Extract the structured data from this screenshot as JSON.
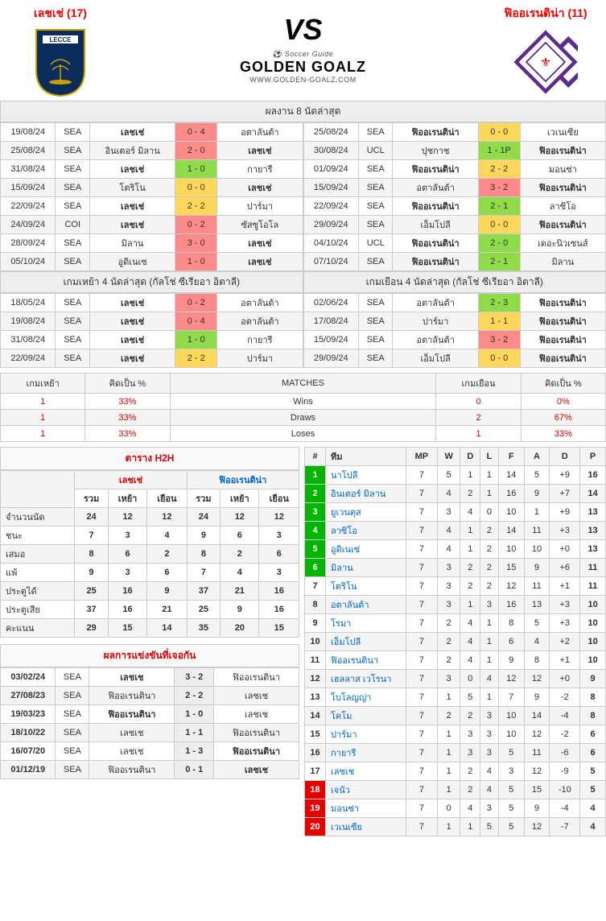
{
  "header": {
    "home_name": "เลชเช่ (17)",
    "away_name": "ฟิออเรนติน่า (11)",
    "vs": "VS",
    "brand_main": "GOLDEN GOALZ",
    "brand_sub_top": "Soccer Guide",
    "brand_sub_bot": "WWW.GOLDEN-GOALZ.COM"
  },
  "sections": {
    "last8": "ผลงาน 8 นัดล่าสุด",
    "home4": "เกมเหย้า 4 นัดล่าสุด (กัลโช่ ซีเรียอา อิตาลี)",
    "away4": "เกมเยือน 4 นัดล่าสุด (กัลโช่ ซีเรียอา อิตาลี)",
    "h2h_table": "ตาราง H2H",
    "h2h_meet": "ผลการแข่งขันที่เจอกัน",
    "wins": "Wins",
    "draws": "Draws",
    "loses": "Loses",
    "matches": "MATCHES",
    "home_g": "เกมเหย้า",
    "away_g": "เกมเยือน",
    "pct": "คิดเป็น %"
  },
  "last8_home": [
    {
      "d": "19/08/24",
      "c": "SEA",
      "h": "เลชเช่",
      "s": "0 - 4",
      "a": "อตาลันต้า",
      "hb": true,
      "cls": "red-box"
    },
    {
      "d": "25/08/24",
      "c": "SEA",
      "h": "อินเตอร์ มิลาน",
      "s": "2 - 0",
      "a": "เลชเช่",
      "ab": true,
      "cls": "red-box"
    },
    {
      "d": "31/08/24",
      "c": "SEA",
      "h": "เลชเช่",
      "s": "1 - 0",
      "a": "กายารี",
      "hb": true,
      "cls": "green-box"
    },
    {
      "d": "15/09/24",
      "c": "SEA",
      "h": "โตริโน",
      "s": "0 - 0",
      "a": "เลชเช่",
      "ab": true,
      "cls": "yellow-box"
    },
    {
      "d": "22/09/24",
      "c": "SEA",
      "h": "เลชเช่",
      "s": "2 - 2",
      "a": "ปาร์มา",
      "hb": true,
      "cls": "yellow-box"
    },
    {
      "d": "24/09/24",
      "c": "COI",
      "h": "เลชเช่",
      "s": "0 - 2",
      "a": "ซัสซูโอโล",
      "hb": true,
      "cls": "red-box"
    },
    {
      "d": "28/09/24",
      "c": "SEA",
      "h": "มิลาน",
      "s": "3 - 0",
      "a": "เลชเช่",
      "ab": true,
      "cls": "red-box"
    },
    {
      "d": "05/10/24",
      "c": "SEA",
      "h": "อูดิเนเซ",
      "s": "1 - 0",
      "a": "เลชเช่",
      "ab": true,
      "cls": "red-box"
    }
  ],
  "last8_away": [
    {
      "d": "25/08/24",
      "c": "SEA",
      "h": "ฟิออเรนติน่า",
      "s": "0 - 0",
      "a": "เวเนเซีย",
      "hb": true,
      "cls": "yellow-box"
    },
    {
      "d": "30/08/24",
      "c": "UCL",
      "h": "ปุชกาช",
      "s": "1 - 1P",
      "a": "ฟิออเรนติน่า",
      "ab": true,
      "cls": "green-box"
    },
    {
      "d": "01/09/24",
      "c": "SEA",
      "h": "ฟิออเรนติน่า",
      "s": "2 - 2",
      "a": "มอนซ่า",
      "hb": true,
      "cls": "yellow-box"
    },
    {
      "d": "15/09/24",
      "c": "SEA",
      "h": "อตาลันต้า",
      "s": "3 - 2",
      "a": "ฟิออเรนติน่า",
      "ab": true,
      "cls": "red-box"
    },
    {
      "d": "22/09/24",
      "c": "SEA",
      "h": "ฟิออเรนติน่า",
      "s": "2 - 1",
      "a": "ลาซิโอ",
      "hb": true,
      "cls": "green-box"
    },
    {
      "d": "29/09/24",
      "c": "SEA",
      "h": "เอ็มโปลี",
      "s": "0 - 0",
      "a": "ฟิออเรนติน่า",
      "ab": true,
      "cls": "yellow-box"
    },
    {
      "d": "04/10/24",
      "c": "UCL",
      "h": "ฟิออเรนติน่า",
      "s": "2 - 0",
      "a": "เดอะนิวเซนส์",
      "hb": true,
      "cls": "green-box"
    },
    {
      "d": "07/10/24",
      "c": "SEA",
      "h": "ฟิออเรนติน่า",
      "s": "2 - 1",
      "a": "มิลาน",
      "hb": true,
      "cls": "green-box"
    }
  ],
  "home4": [
    {
      "d": "18/05/24",
      "c": "SEA",
      "h": "เลชเช่",
      "s": "0 - 2",
      "a": "อตาลันต้า",
      "hb": true,
      "cls": "red-box"
    },
    {
      "d": "19/08/24",
      "c": "SEA",
      "h": "เลชเช่",
      "s": "0 - 4",
      "a": "อตาลันต้า",
      "hb": true,
      "cls": "red-box"
    },
    {
      "d": "31/08/24",
      "c": "SEA",
      "h": "เลชเช่",
      "s": "1 - 0",
      "a": "กายารี",
      "hb": true,
      "cls": "green-box"
    },
    {
      "d": "22/09/24",
      "c": "SEA",
      "h": "เลชเช่",
      "s": "2 - 2",
      "a": "ปาร์มา",
      "hb": true,
      "cls": "yellow-box"
    }
  ],
  "away4": [
    {
      "d": "02/06/24",
      "c": "SEA",
      "h": "อตาลันต้า",
      "s": "2 - 3",
      "a": "ฟิออเรนติน่า",
      "ab": true,
      "cls": "green-box"
    },
    {
      "d": "17/08/24",
      "c": "SEA",
      "h": "ปาร์มา",
      "s": "1 - 1",
      "a": "ฟิออเรนติน่า",
      "ab": true,
      "cls": "yellow-box"
    },
    {
      "d": "15/09/24",
      "c": "SEA",
      "h": "อตาลันต้า",
      "s": "3 - 2",
      "a": "ฟิออเรนติน่า",
      "ab": true,
      "cls": "red-box"
    },
    {
      "d": "29/09/24",
      "c": "SEA",
      "h": "เอ็มโปลี",
      "s": "0 - 0",
      "a": "ฟิออเรนติน่า",
      "ab": true,
      "cls": "yellow-box"
    }
  ],
  "summary": {
    "home": {
      "w": "1",
      "wp": "33%",
      "d": "1",
      "dp": "33%",
      "l": "1",
      "lp": "33%"
    },
    "away": {
      "w": "0",
      "wp": "0%",
      "d": "2",
      "dp": "67%",
      "l": "1",
      "lp": "33%"
    }
  },
  "h2h": {
    "team_l": "เลชเช่",
    "team_r": "ฟิออเรนติน่า",
    "cols": [
      "รวม",
      "เหย้า",
      "เยือน"
    ],
    "rows": [
      {
        "label": "จำนวนนัด",
        "l": [
          "24",
          "12",
          "12"
        ],
        "r": [
          "24",
          "12",
          "12"
        ]
      },
      {
        "label": "ชนะ",
        "l": [
          "7",
          "3",
          "4"
        ],
        "r": [
          "9",
          "6",
          "3"
        ]
      },
      {
        "label": "เสมอ",
        "l": [
          "8",
          "6",
          "2"
        ],
        "r": [
          "8",
          "2",
          "6"
        ]
      },
      {
        "label": "แพ้",
        "l": [
          "9",
          "3",
          "6"
        ],
        "r": [
          "7",
          "4",
          "3"
        ]
      },
      {
        "label": "ประตูได้",
        "l": [
          "25",
          "16",
          "9"
        ],
        "r": [
          "37",
          "21",
          "16"
        ]
      },
      {
        "label": "ประตูเสีย",
        "l": [
          "37",
          "16",
          "21"
        ],
        "r": [
          "25",
          "9",
          "16"
        ]
      },
      {
        "label": "คะแนน",
        "l": [
          "29",
          "15",
          "14"
        ],
        "r": [
          "35",
          "20",
          "15"
        ]
      }
    ]
  },
  "meetings": [
    {
      "d": "03/02/24",
      "c": "SEA",
      "h": "เลชเช",
      "s": "3 - 2",
      "a": "ฟิออเรนตินา",
      "hb": true
    },
    {
      "d": "27/08/23",
      "c": "SEA",
      "h": "ฟิออเรนตินา",
      "s": "2 - 2",
      "a": "เลชเช"
    },
    {
      "d": "19/03/23",
      "c": "SEA",
      "h": "ฟิออเรนตินา",
      "s": "1 - 0",
      "a": "เลชเช",
      "hb": true
    },
    {
      "d": "18/10/22",
      "c": "SEA",
      "h": "เลชเช",
      "s": "1 - 1",
      "a": "ฟิออเรนตินา"
    },
    {
      "d": "16/07/20",
      "c": "SEA",
      "h": "เลชเช",
      "s": "1 - 3",
      "a": "ฟิออเรนตินา",
      "ab": true
    },
    {
      "d": "01/12/19",
      "c": "SEA",
      "h": "ฟิออเรนตินา",
      "s": "0 - 1",
      "a": "เลชเช",
      "ab": true
    }
  ],
  "league": {
    "headers": [
      "#",
      "ทีม",
      "MP",
      "W",
      "D",
      "L",
      "F",
      "A",
      "D",
      "P"
    ],
    "rows": [
      {
        "r": 1,
        "t": "นาโปลี",
        "mp": 7,
        "w": 5,
        "d": 1,
        "l": 1,
        "f": 14,
        "a": 5,
        "gd": "+9",
        "p": 16,
        "c": "g"
      },
      {
        "r": 2,
        "t": "อินเตอร์ มิลาน",
        "mp": 7,
        "w": 4,
        "d": 2,
        "l": 1,
        "f": 16,
        "a": 9,
        "gd": "+7",
        "p": 14,
        "c": "g"
      },
      {
        "r": 3,
        "t": "ยูเวนตุส",
        "mp": 7,
        "w": 3,
        "d": 4,
        "l": 0,
        "f": 10,
        "a": 1,
        "gd": "+9",
        "p": 13,
        "c": "g"
      },
      {
        "r": 4,
        "t": "ลาซิโอ",
        "mp": 7,
        "w": 4,
        "d": 1,
        "l": 2,
        "f": 14,
        "a": 11,
        "gd": "+3",
        "p": 13,
        "c": "g"
      },
      {
        "r": 5,
        "t": "อูดิเนเซ่",
        "mp": 7,
        "w": 4,
        "d": 1,
        "l": 2,
        "f": 10,
        "a": 10,
        "gd": "+0",
        "p": 13,
        "c": "g"
      },
      {
        "r": 6,
        "t": "มิลาน",
        "mp": 7,
        "w": 3,
        "d": 2,
        "l": 2,
        "f": 15,
        "a": 9,
        "gd": "+6",
        "p": 11,
        "c": "g"
      },
      {
        "r": 7,
        "t": "โตริโน",
        "mp": 7,
        "w": 3,
        "d": 2,
        "l": 2,
        "f": 12,
        "a": 11,
        "gd": "+1",
        "p": 11,
        "c": ""
      },
      {
        "r": 8,
        "t": "อตาลันต้า",
        "mp": 7,
        "w": 3,
        "d": 1,
        "l": 3,
        "f": 16,
        "a": 13,
        "gd": "+3",
        "p": 10,
        "c": ""
      },
      {
        "r": 9,
        "t": "โรมา",
        "mp": 7,
        "w": 2,
        "d": 4,
        "l": 1,
        "f": 8,
        "a": 5,
        "gd": "+3",
        "p": 10,
        "c": ""
      },
      {
        "r": 10,
        "t": "เอ็มโปลี",
        "mp": 7,
        "w": 2,
        "d": 4,
        "l": 1,
        "f": 6,
        "a": 4,
        "gd": "+2",
        "p": 10,
        "c": ""
      },
      {
        "r": 11,
        "t": "ฟิออเรนตินา",
        "mp": 7,
        "w": 2,
        "d": 4,
        "l": 1,
        "f": 9,
        "a": 8,
        "gd": "+1",
        "p": 10,
        "c": ""
      },
      {
        "r": 12,
        "t": "เฮลลาส เวโรนา",
        "mp": 7,
        "w": 3,
        "d": 0,
        "l": 4,
        "f": 12,
        "a": 12,
        "gd": "+0",
        "p": 9,
        "c": ""
      },
      {
        "r": 13,
        "t": "โบโลญญ่า",
        "mp": 7,
        "w": 1,
        "d": 5,
        "l": 1,
        "f": 7,
        "a": 9,
        "gd": "-2",
        "p": 8,
        "c": ""
      },
      {
        "r": 14,
        "t": "โคโม",
        "mp": 7,
        "w": 2,
        "d": 2,
        "l": 3,
        "f": 10,
        "a": 14,
        "gd": "-4",
        "p": 8,
        "c": ""
      },
      {
        "r": 15,
        "t": "ปาร์มา",
        "mp": 7,
        "w": 1,
        "d": 3,
        "l": 3,
        "f": 10,
        "a": 12,
        "gd": "-2",
        "p": 6,
        "c": ""
      },
      {
        "r": 16,
        "t": "กายารี",
        "mp": 7,
        "w": 1,
        "d": 3,
        "l": 3,
        "f": 5,
        "a": 11,
        "gd": "-6",
        "p": 6,
        "c": ""
      },
      {
        "r": 17,
        "t": "เลชเช",
        "mp": 7,
        "w": 1,
        "d": 2,
        "l": 4,
        "f": 3,
        "a": 12,
        "gd": "-9",
        "p": 5,
        "c": ""
      },
      {
        "r": 18,
        "t": "เจนัว",
        "mp": 7,
        "w": 1,
        "d": 2,
        "l": 4,
        "f": 5,
        "a": 15,
        "gd": "-10",
        "p": 5,
        "c": "r"
      },
      {
        "r": 19,
        "t": "มอนซ่า",
        "mp": 7,
        "w": 0,
        "d": 4,
        "l": 3,
        "f": 5,
        "a": 9,
        "gd": "-4",
        "p": 4,
        "c": "r"
      },
      {
        "r": 20,
        "t": "เวเนเซีย",
        "mp": 7,
        "w": 1,
        "d": 1,
        "l": 5,
        "f": 5,
        "a": 12,
        "gd": "-7",
        "p": 4,
        "c": "r"
      }
    ]
  }
}
